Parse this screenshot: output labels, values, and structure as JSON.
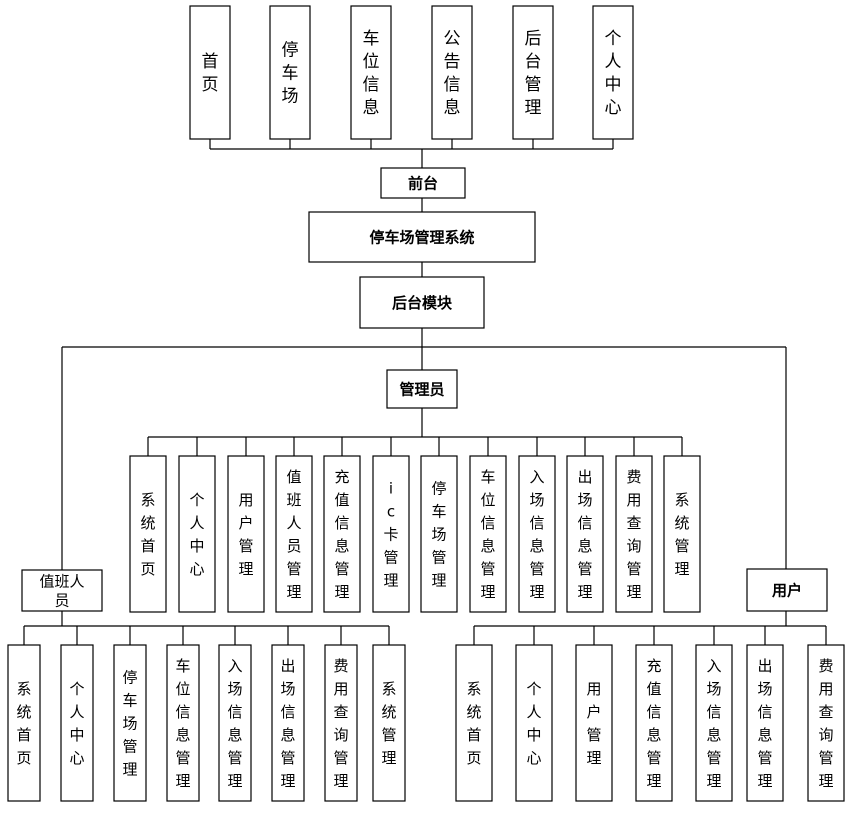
{
  "diagram": {
    "type": "tree",
    "colors": {
      "line": "#000000",
      "box_fill": "#ffffff",
      "text": "#000000"
    },
    "top_modules": [
      {
        "id": "home",
        "label": "首页"
      },
      {
        "id": "parking",
        "label": "停车场"
      },
      {
        "id": "spot-info",
        "label": "车位信息"
      },
      {
        "id": "notice-info",
        "label": "公告信息"
      },
      {
        "id": "backend-mgmt",
        "label": "后台管理"
      },
      {
        "id": "personal-center",
        "label": "个人中心"
      }
    ],
    "frontend": {
      "id": "frontend",
      "label": "前台"
    },
    "system": {
      "id": "system",
      "label": "停车场管理系统"
    },
    "backend": {
      "id": "backend",
      "label": "后台模块"
    },
    "admin": {
      "id": "admin",
      "label": "管理员",
      "modules": [
        {
          "id": "sys-home",
          "label": "系统首页"
        },
        {
          "id": "personal-center",
          "label": "个人中心"
        },
        {
          "id": "user-mgmt",
          "label": "用户管理"
        },
        {
          "id": "staff-mgmt",
          "label": "值班人员管理"
        },
        {
          "id": "recharge-mgmt",
          "label": "充值信息管理"
        },
        {
          "id": "ic-card-mgmt",
          "label": "ic卡管理"
        },
        {
          "id": "parking-mgmt",
          "label": "停车场管理"
        },
        {
          "id": "spot-info-mgmt",
          "label": "车位信息管理"
        },
        {
          "id": "entry-info-mgmt",
          "label": "入场信息管理"
        },
        {
          "id": "exit-info-mgmt",
          "label": "出场信息管理"
        },
        {
          "id": "fee-query-mgmt",
          "label": "费用查询管理"
        },
        {
          "id": "sys-mgmt",
          "label": "系统管理"
        }
      ]
    },
    "duty_staff": {
      "id": "duty-staff",
      "label": "值班人员",
      "modules": [
        {
          "id": "sys-home",
          "label": "系统首页"
        },
        {
          "id": "personal-center",
          "label": "个人中心"
        },
        {
          "id": "parking-mgmt",
          "label": "停车场管理"
        },
        {
          "id": "spot-info-mgmt",
          "label": "车位信息管理"
        },
        {
          "id": "entry-info-mgmt",
          "label": "入场信息管理"
        },
        {
          "id": "exit-info-mgmt",
          "label": "出场信息管理"
        },
        {
          "id": "fee-query-mgmt",
          "label": "费用查询管理"
        },
        {
          "id": "sys-mgmt",
          "label": "系统管理"
        }
      ]
    },
    "user": {
      "id": "user",
      "label": "用户",
      "modules": [
        {
          "id": "sys-home",
          "label": "系统首页"
        },
        {
          "id": "personal-center",
          "label": "个人中心"
        },
        {
          "id": "user-mgmt",
          "label": "用户管理"
        },
        {
          "id": "recharge-mgmt",
          "label": "充值信息管理"
        },
        {
          "id": "entry-info-mgmt",
          "label": "入场信息管理"
        },
        {
          "id": "exit-info-mgmt",
          "label": "出场信息管理"
        },
        {
          "id": "fee-query-mgmt",
          "label": "费用查询管理"
        }
      ]
    }
  }
}
